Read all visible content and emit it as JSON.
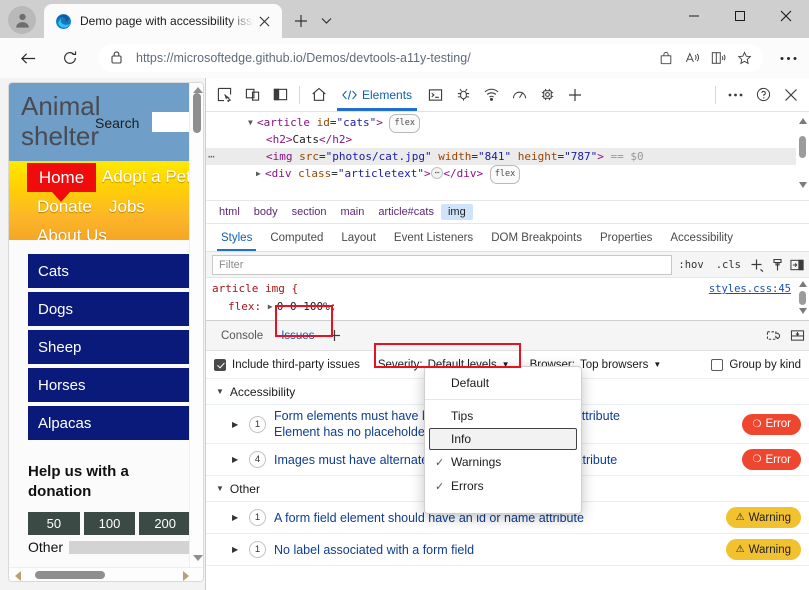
{
  "browser": {
    "tab": {
      "title": "Demo page with accessibility issues",
      "favicon": "edge-logo-icon"
    },
    "newtab_label": "+",
    "window_controls": {
      "minimize": "—",
      "maximize": "□",
      "close": "✕"
    },
    "omnibox": {
      "url": "https://microsoftedge.github.io/Demos/devtools-a11y-testing/",
      "lock_icon": "lock-icon",
      "actions": [
        "shopping-bag-icon",
        "read-aloud-icon",
        "immersive-reader-icon",
        "favorite-star-icon"
      ]
    },
    "nav": {
      "back": "back-arrow-icon",
      "reload": "reload-icon",
      "more": "ellipsis-icon"
    }
  },
  "webpage": {
    "title": "Animal shelter",
    "search_label": "Search",
    "search_value": "",
    "nav": [
      "Home",
      "Adopt a Pet",
      "Donate",
      "Jobs",
      "About Us"
    ],
    "categories": [
      "Cats",
      "Dogs",
      "Sheep",
      "Horses",
      "Alpacas"
    ],
    "donation_heading": "Help us with a donation",
    "amounts": [
      "50",
      "100",
      "200"
    ],
    "other_label": "Other"
  },
  "devtools": {
    "toolbar_icons": [
      "inspect-element-icon",
      "device-emulation-icon",
      "dock-side-icon"
    ],
    "panels": [
      {
        "label": "Elements",
        "icon": "code-brackets-icon",
        "active": true
      }
    ],
    "home_icon": "home-icon",
    "right_icons": [
      "console-icon",
      "debugger-icon",
      "network-icon",
      "performance-icon",
      "memory-icon",
      "add-panel-icon"
    ],
    "overflow_icons": [
      "ellipsis-icon",
      "help-icon",
      "close-icon"
    ],
    "dom": {
      "lines": [
        {
          "indent": 2,
          "tri": "▼",
          "text": "<article id=\"cats\">",
          "badge": "flex"
        },
        {
          "indent": 3,
          "tri": "",
          "text": "<h2>Cats</h2>"
        },
        {
          "indent": 3,
          "tri": "",
          "text": "<img src=\"photos/cat.jpg\" width=\"841\" height=\"787\">",
          "suffix": "== $0",
          "selected": true
        },
        {
          "indent": 2,
          "tri": "▶",
          "text": "<div class=\"articletext\">…</div>",
          "badge": "flex"
        }
      ]
    },
    "breadcrumb": [
      "html",
      "body",
      "section",
      "main",
      "article#cats",
      "img"
    ],
    "breadcrumb_active": "img",
    "styles_tabs": [
      "Styles",
      "Computed",
      "Layout",
      "Event Listeners",
      "DOM Breakpoints",
      "Properties",
      "Accessibility"
    ],
    "styles_tab_active": "Styles",
    "filter_placeholder": "Filter",
    "filter_actions": [
      ":hov",
      ".cls",
      "add-style-rule-icon",
      "element-state-icon",
      "copy-styles-icon"
    ],
    "css_rule": {
      "selector": "article img {",
      "property": "flex:",
      "value": "0 0 100%;",
      "source": "styles.css:45"
    },
    "drawer": {
      "tabs": [
        "Console",
        "Issues"
      ],
      "tab_active": "Issues",
      "add_label": "+",
      "actions": [
        "settings-gear-icon",
        "dock-drawer-icon"
      ],
      "filters": {
        "include_third_party_label": "Include third-party issues",
        "include_third_party_checked": true,
        "severity_label": "Severity:",
        "severity_value": "Default levels",
        "browser_label": "Browser:",
        "browser_value": "Top browsers",
        "group_by_kind_label": "Group by kind",
        "group_by_kind_checked": false
      },
      "severity_menu": {
        "open": true,
        "items": [
          {
            "label": "Default",
            "checked": false,
            "divider_after": true
          },
          {
            "label": "Tips",
            "checked": false
          },
          {
            "label": "Info",
            "checked": false,
            "highlighted": true
          },
          {
            "label": "Warnings",
            "checked": true
          },
          {
            "label": "Errors",
            "checked": true
          }
        ]
      },
      "groups": [
        {
          "name": "Accessibility",
          "expanded": true,
          "issues": [
            {
              "count": "1",
              "text": "Form elements must have labels: Element has no title attribute",
              "subtext": "Element has no placeholder attribute",
              "severity": "Error"
            },
            {
              "count": "4",
              "text": "Images must have alternate text: Element has no title attribute",
              "subtext": "",
              "severity": "Error"
            }
          ]
        },
        {
          "name": "Other",
          "expanded": true,
          "issues": [
            {
              "count": "1",
              "text": "A form field element should have an id or name attribute",
              "subtext": "",
              "severity": "Warning"
            },
            {
              "count": "1",
              "text": "No label associated with a form field",
              "subtext": "",
              "severity": "Warning"
            }
          ]
        }
      ]
    }
  },
  "colors": {
    "error_pill": "#ee462f",
    "warning_pill": "#f2c12e",
    "annotation": "#e81123",
    "devtools_accent": "#1f6fd0",
    "shelter_header": "#6f9fc8",
    "shelter_home": "#f00c0c",
    "shelter_category": "#0a1a7a"
  }
}
